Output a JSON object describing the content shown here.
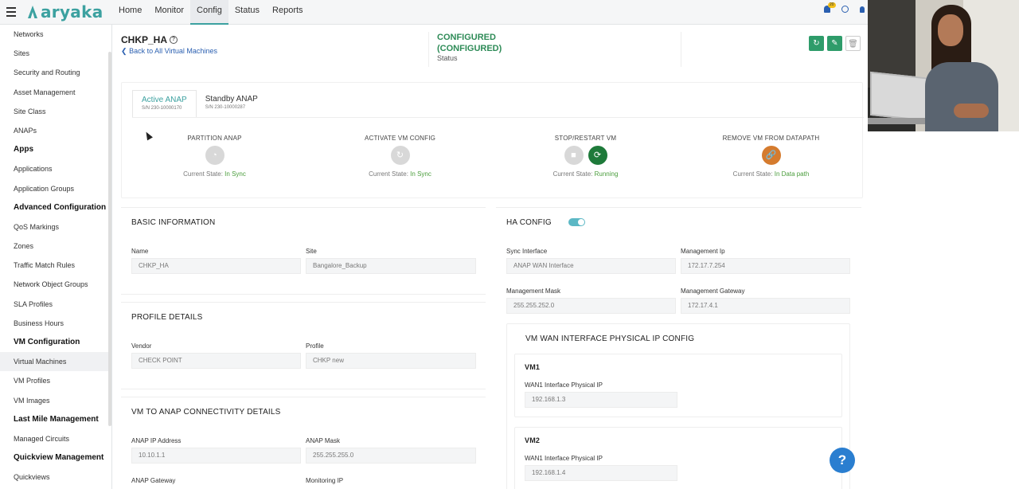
{
  "brand": {
    "name": "aryaka"
  },
  "nav": [
    {
      "label": "Home"
    },
    {
      "label": "Monitor"
    },
    {
      "label": "Config"
    },
    {
      "label": "Status"
    },
    {
      "label": "Reports"
    }
  ],
  "notifications": {
    "count": "20"
  },
  "sidebar": {
    "items": [
      {
        "label": "Networks",
        "type": "item"
      },
      {
        "label": "Sites",
        "type": "item"
      },
      {
        "label": "Security and Routing",
        "type": "item"
      },
      {
        "label": "Asset Management",
        "type": "item"
      },
      {
        "label": "Site Class",
        "type": "item"
      },
      {
        "label": "ANAPs",
        "type": "item"
      },
      {
        "label": "Apps",
        "type": "cat"
      },
      {
        "label": "Applications",
        "type": "item"
      },
      {
        "label": "Application Groups",
        "type": "item"
      },
      {
        "label": "Advanced Configuration",
        "type": "cat"
      },
      {
        "label": "QoS Markings",
        "type": "item"
      },
      {
        "label": "Zones",
        "type": "item"
      },
      {
        "label": "Traffic Match Rules",
        "type": "item"
      },
      {
        "label": "Network Object Groups",
        "type": "item"
      },
      {
        "label": "SLA Profiles",
        "type": "item"
      },
      {
        "label": "Business Hours",
        "type": "item"
      },
      {
        "label": "VM Configuration",
        "type": "cat"
      },
      {
        "label": "Virtual Machines",
        "type": "item"
      },
      {
        "label": "VM Profiles",
        "type": "item"
      },
      {
        "label": "VM Images",
        "type": "item"
      },
      {
        "label": "Last Mile Management",
        "type": "cat"
      },
      {
        "label": "Managed Circuits",
        "type": "item"
      },
      {
        "label": "Quickview Management",
        "type": "cat"
      },
      {
        "label": "Quickviews",
        "type": "item"
      }
    ]
  },
  "header": {
    "title": "CHKP_HA",
    "back_link": "Back to All Virtual Machines",
    "status_value": "CONFIGURED (CONFIGURED)",
    "status_label": "Status"
  },
  "tabs": [
    {
      "label": "Active ANAP",
      "serial": "S/N 230-10000170"
    },
    {
      "label": "Standby ANAP",
      "serial": "S/N 230-10000287"
    }
  ],
  "operations": [
    {
      "label": "PARTITION ANAP",
      "state_prefix": "Current State:",
      "state": "In Sync"
    },
    {
      "label": "ACTIVATE VM CONFIG",
      "state_prefix": "Current State:",
      "state": "In Sync"
    },
    {
      "label": "STOP/RESTART VM",
      "state_prefix": "Current State:",
      "state": "Running"
    },
    {
      "label": "REMOVE VM FROM DATAPATH",
      "state_prefix": "Current State:",
      "state": "In Data path"
    }
  ],
  "basic_info": {
    "title": "BASIC INFORMATION",
    "name_label": "Name",
    "name_value": "CHKP_HA",
    "site_label": "Site",
    "site_value": "Bangalore_Backup"
  },
  "profile_details": {
    "title": "PROFILE DETAILS",
    "vendor_label": "Vendor",
    "vendor_value": "CHECK POINT",
    "profile_label": "Profile",
    "profile_value": "CHKP new"
  },
  "connectivity": {
    "title": "VM TO ANAP CONNECTIVITY DETAILS",
    "ip_label": "ANAP IP Address",
    "ip_value": "10.10.1.1",
    "mask_label": "ANAP Mask",
    "mask_value": "255.255.255.0",
    "gw_label": "ANAP Gateway",
    "mon_label": "Monitoring IP"
  },
  "ha_config": {
    "title": "HA CONFIG",
    "enabled": true,
    "sync_label": "Sync Interface",
    "sync_value": "ANAP WAN Interface",
    "mip_label": "Management Ip",
    "mip_value": "172.17.7.254",
    "mmask_label": "Management Mask",
    "mmask_value": "255.255.252.0",
    "mgw_label": "Management Gateway",
    "mgw_value": "172.17.4.1",
    "wan_title": "VM WAN INTERFACE PHYSICAL IP CONFIG",
    "vm1_title": "VM1",
    "vm1_label": "WAN1 Interface Physical IP",
    "vm1_value": "192.168.1.3",
    "vm2_title": "VM2",
    "vm2_label": "WAN1 Interface Physical IP",
    "vm2_value": "192.168.1.4"
  },
  "help_fab": "?"
}
